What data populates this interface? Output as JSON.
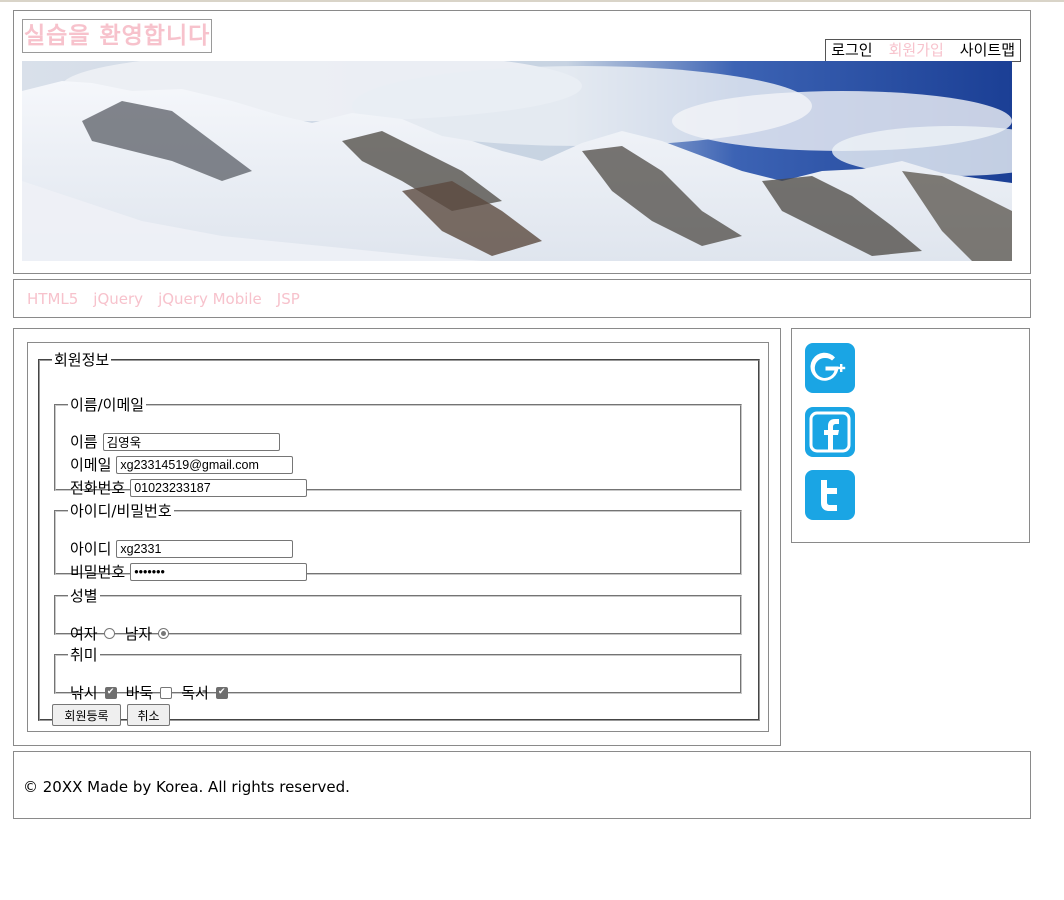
{
  "header": {
    "site_title": "실습을 환영합니다",
    "top_menu": [
      {
        "label": "로그인"
      },
      {
        "label": "회원가입"
      },
      {
        "label": "사이트맵"
      }
    ]
  },
  "nav": {
    "links": [
      {
        "label": "HTML5"
      },
      {
        "label": "jQuery"
      },
      {
        "label": "jQuery Mobile"
      },
      {
        "label": "JSP"
      }
    ]
  },
  "form": {
    "legend": "회원정보",
    "name_email": {
      "legend": "이름/이메일",
      "name_label": "이름",
      "name_value": "김영욱",
      "email_label": "이메일",
      "email_value": "xg23314519@gmail.com",
      "phone_label": "전화번호",
      "phone_value": "01023233187"
    },
    "account": {
      "legend": "아이디/비밀번호",
      "id_label": "아이디",
      "id_value": "xg2331",
      "password_label": "비밀번호",
      "password_value": "•••••••"
    },
    "gender": {
      "legend": "성별",
      "female_label": "여자",
      "male_label": "남자",
      "selected": "남자"
    },
    "hobby": {
      "legend": "취미",
      "items": [
        {
          "label": "낚시",
          "checked": true
        },
        {
          "label": "바둑",
          "checked": false
        },
        {
          "label": "독서",
          "checked": true
        }
      ]
    },
    "submit_label": "회원등록",
    "cancel_label": "취소"
  },
  "sidebar": {
    "icons": [
      "google-plus-icon",
      "facebook-icon",
      "twitter-icon"
    ],
    "icon_color": "#1aa5e4"
  },
  "footer": {
    "text": "© 20XX Made by Korea. All rights reserved."
  },
  "colors": {
    "accent_pink": "#f7c2cc",
    "border": "#8a8a8a"
  }
}
